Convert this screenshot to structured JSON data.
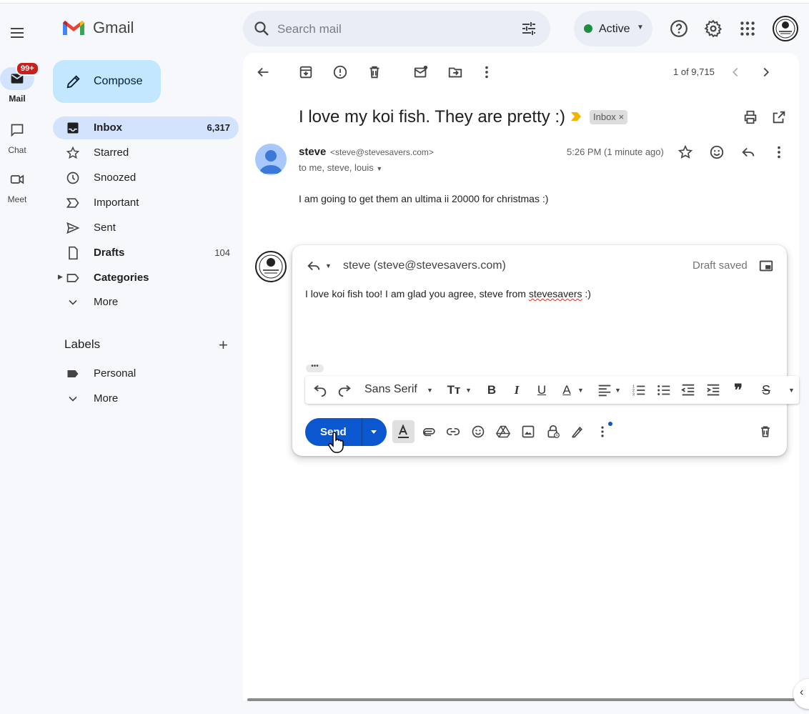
{
  "app": {
    "name": "Gmail"
  },
  "rail": {
    "items": [
      {
        "label": "Mail",
        "badge": "99+"
      },
      {
        "label": "Chat"
      },
      {
        "label": "Meet"
      }
    ]
  },
  "search": {
    "placeholder": "Search mail"
  },
  "status": {
    "label": "Active"
  },
  "compose": {
    "label": "Compose"
  },
  "nav": {
    "items": [
      {
        "label": "Inbox",
        "count": "6,317"
      },
      {
        "label": "Starred"
      },
      {
        "label": "Snoozed"
      },
      {
        "label": "Important"
      },
      {
        "label": "Sent"
      },
      {
        "label": "Drafts",
        "count": "104"
      },
      {
        "label": "Categories"
      },
      {
        "label": "More"
      }
    ]
  },
  "labels": {
    "title": "Labels",
    "items": [
      {
        "label": "Personal"
      },
      {
        "label": "More"
      }
    ]
  },
  "toolbar": {
    "pager": "1 of 9,715"
  },
  "thread": {
    "subject": "I love my koi fish. They are pretty :)",
    "label_chip": "Inbox",
    "label_chip_close": "×",
    "message": {
      "sender_name": "steve",
      "sender_email": "<steve@stevesavers.com>",
      "to": "to me, steve, louis",
      "time": "5:26 PM (1 minute ago)",
      "body": "I am going to get them an ultima ii 20000 for christmas :)"
    }
  },
  "reply": {
    "to": "steve (steve@stevesavers.com)",
    "status": "Draft saved",
    "body_before": "I love koi fish too! I am glad you agree, steve from ",
    "body_misspelled": "stevesavers",
    "body_after": " :)",
    "more_dots": "•••",
    "font": "Sans Serif",
    "send_label": "Send"
  },
  "colors": {
    "accent": "#0b57d0",
    "compose_bg": "#c2e7ff",
    "nav_active": "#d3e3fd",
    "badge": "#c5221f",
    "active_green": "#1e8e3e"
  }
}
